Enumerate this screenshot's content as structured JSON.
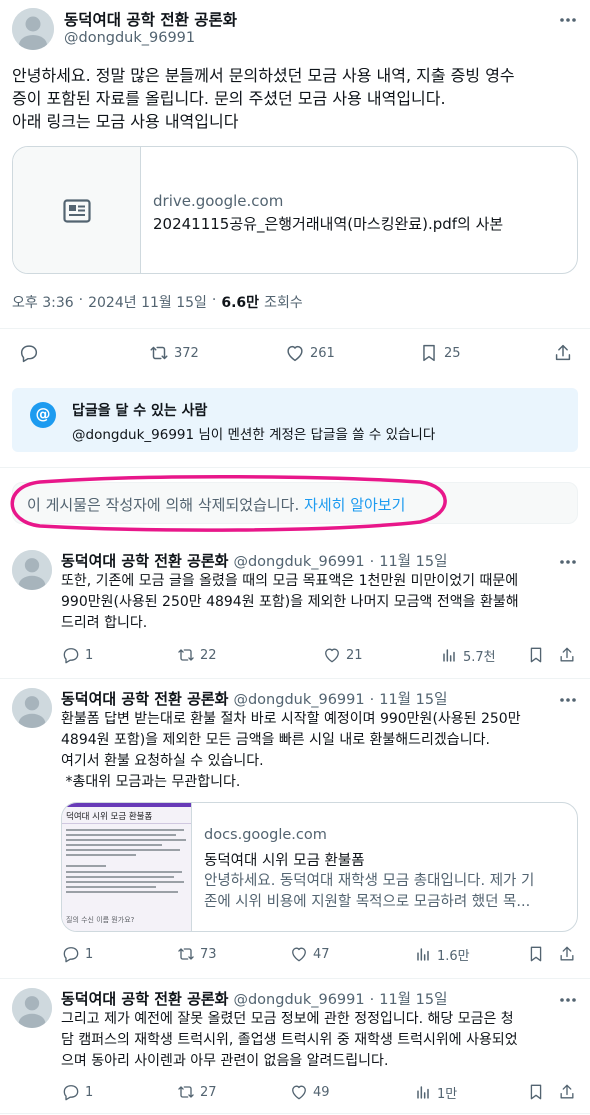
{
  "main_post": {
    "display_name": "동덕여대 공학 전환 공론화",
    "handle": "@dongduk_96991",
    "body_lines": [
      "안녕하세요. 정말 많은 분들께서 문의하셨던 모금 사용 내역, 지출 증빙 영수",
      "증이 포함된 자료를 올립니다. 문의 주셨던 모금 사용 내역입니다.",
      "아래 링크는 모금 사용 내역입니다"
    ],
    "link_card": {
      "domain": "drive.google.com",
      "title": "20241115공유_은행거래내역(마스킹완료).pdf의 사본"
    },
    "meta": {
      "time": "오후 3:36",
      "date": "2024년 11월 15일",
      "views": "6.6만",
      "views_label": "조회수",
      "separator": "·"
    },
    "stats": {
      "retweets": "372",
      "likes": "261",
      "bookmarks": "25"
    }
  },
  "reply_restriction": {
    "title": "답글을 달 수 있는 사람",
    "description": "@dongduk_96991 님이 멘션한 계정은 답글을 쓸 수 있습니다"
  },
  "deleted_notice": {
    "text": "이 게시물은 작성자에 의해 삭제되었습니다.",
    "link": "자세히 알아보기"
  },
  "replies": [
    {
      "display_name": "동덕여대 공학 전환 공론화",
      "handle": "@dongduk_96991",
      "date": "11월 15일",
      "body_lines": [
        "또한, 기존에 모금 글을 올렸을 때의 모금 목표액은 1천만원 미만이었기 때문에",
        "990만원(사용된 250만 4894원 포함)을 제외한 나머지 모금액 전액을 환불해",
        "드리려 합니다."
      ],
      "replies": "1",
      "retweets": "22",
      "likes": "21",
      "views": "5.7천"
    },
    {
      "display_name": "동덕여대 공학 전환 공론화",
      "handle": "@dongduk_96991",
      "date": "11월 15일",
      "body_lines": [
        "환불폼 답변 받는대로 환불 절차 바로 시작할 예정이며 990만원(사용된 250만",
        "4894원 포함)을 제외한 모든 금액을 빠른 시일 내로 환불해드리겠습니다.",
        "여기서 환불 요청하실 수 있습니다.",
        " *총대위 모금과는 무관합니다."
      ],
      "link_card": {
        "domain": "docs.google.com",
        "title": "동덕여대 시위 모금 환불폼",
        "desc_lines": [
          "안녕하세요. 동덕여대 재학생 모금 총대입니다. 제가 기",
          "존에 시위 비용에 지원할 목적으로 모금하려 했던 목..."
        ],
        "thumb_title": "덕여대 시위 모금 환불폼",
        "thumb_question": "질의 수신 이름 뭔가요?"
      },
      "replies": "1",
      "retweets": "73",
      "likes": "47",
      "views": "1.6만"
    },
    {
      "display_name": "동덕여대 공학 전환 공론화",
      "handle": "@dongduk_96991",
      "date": "11월 15일",
      "body_lines": [
        "그리고 제가 예전에 잘못 올렸던 모금 정보에 관한 정정입니다. 해당 모금은 청",
        "담 캠퍼스의 재학생 트럭시위, 졸업생 트럭시위 중 재학생 트럭시위에 사용되었",
        "으며 동아리 사이렌과 아무 관련이 없음을 알려드립니다."
      ],
      "replies": "1",
      "retweets": "27",
      "likes": "49",
      "views": "1만"
    }
  ],
  "colors": {
    "accent": "#1d9bf0",
    "muted": "#536471",
    "highlight_ellipse": "#e8178a"
  }
}
